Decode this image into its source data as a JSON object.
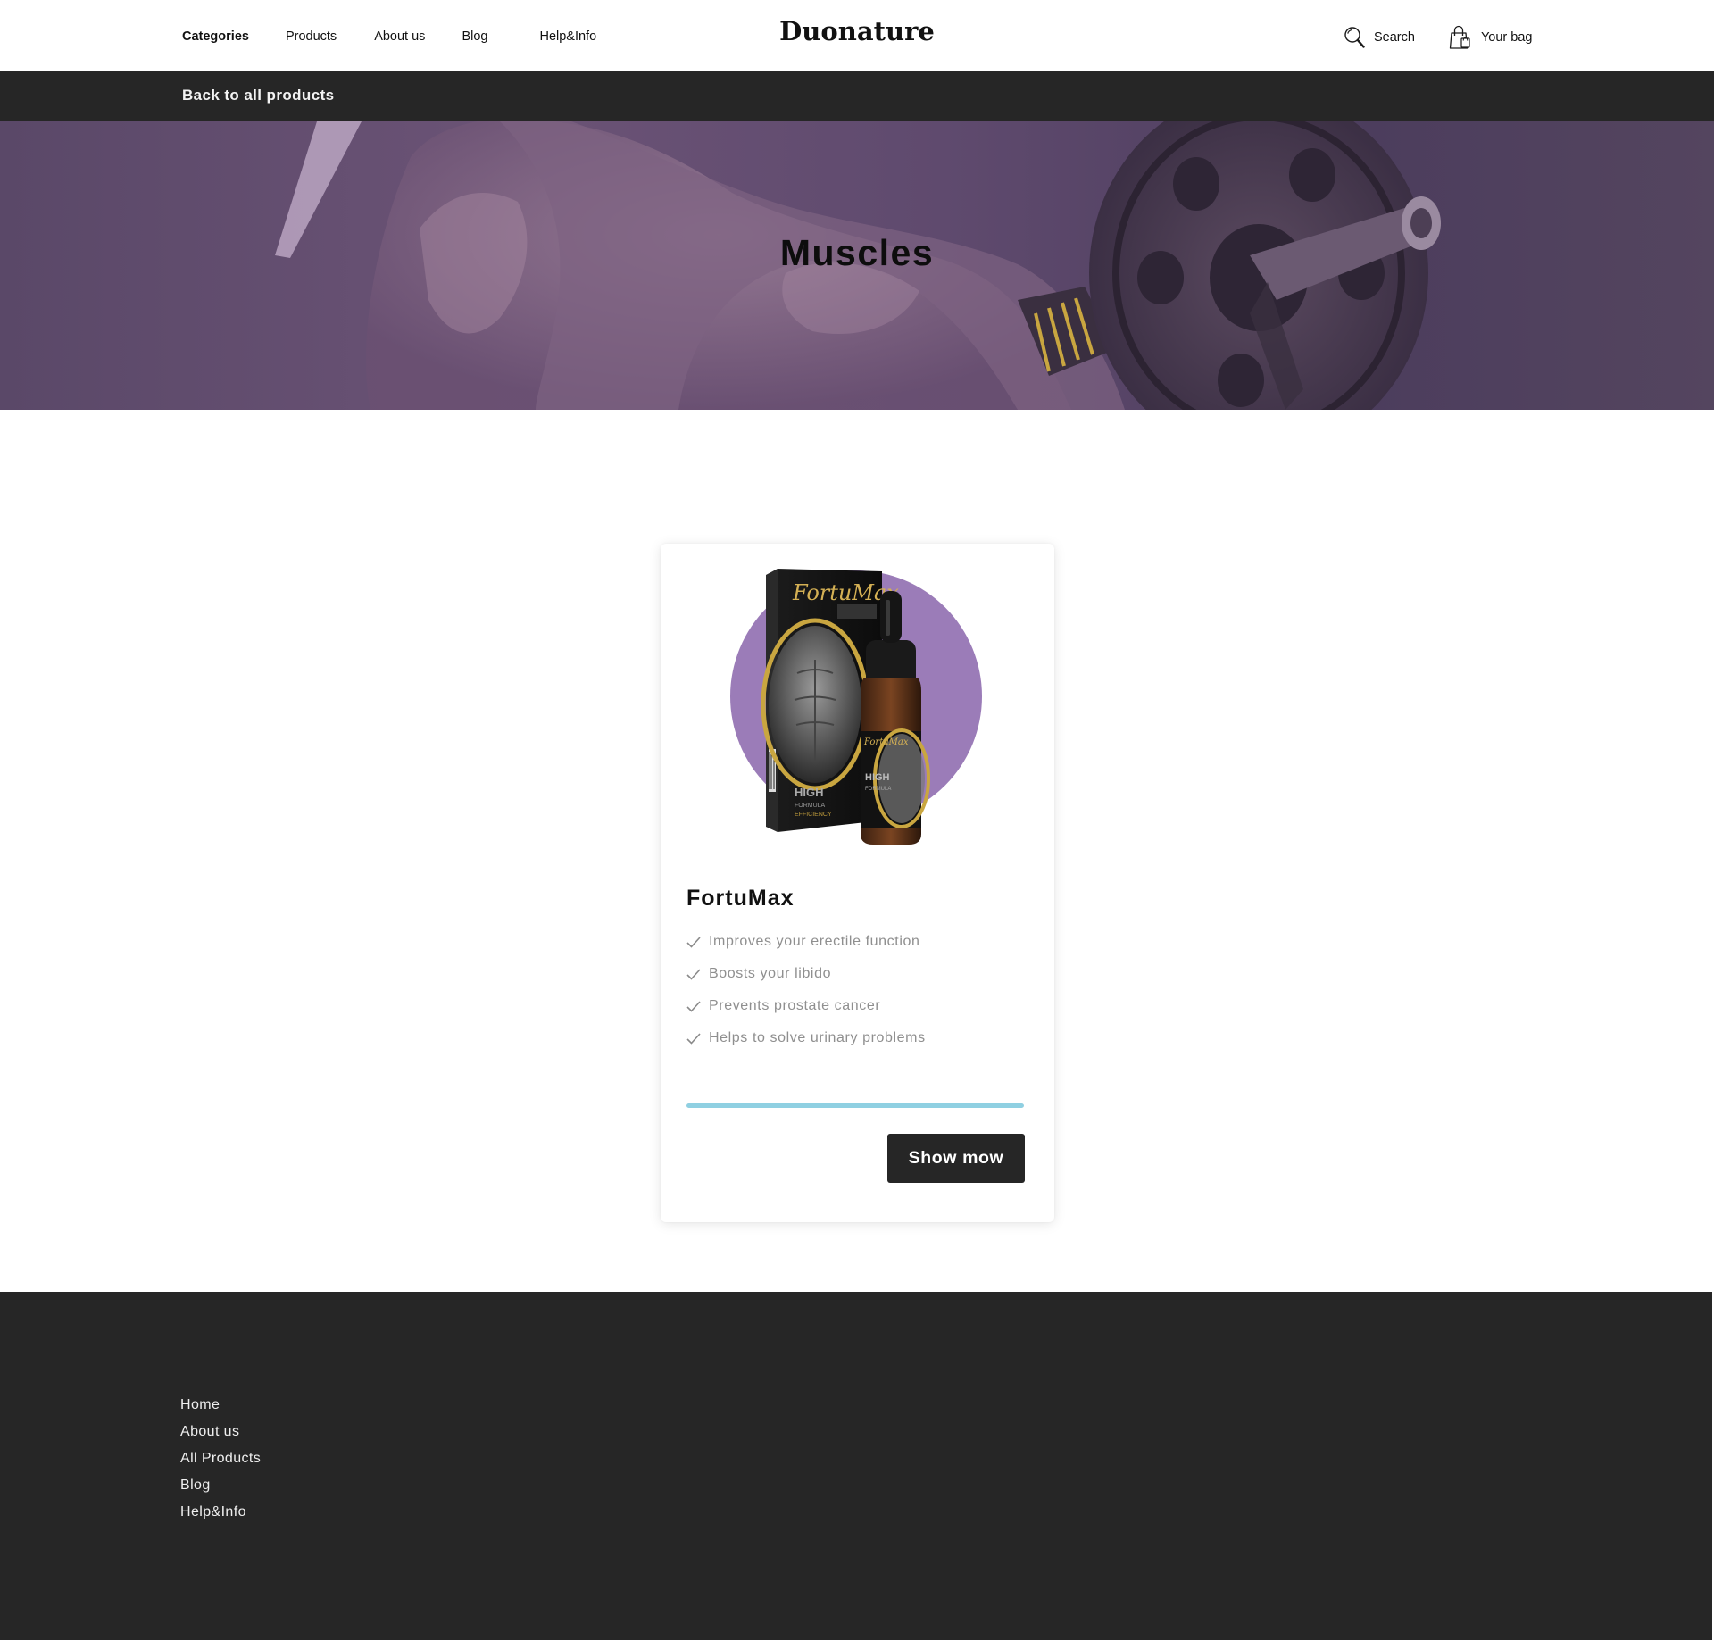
{
  "header": {
    "nav": [
      {
        "label": "Categories",
        "active": true
      },
      {
        "label": "Products",
        "active": false
      },
      {
        "label": "About us",
        "active": false
      },
      {
        "label": "Blog",
        "active": false
      },
      {
        "label": "Help&Info",
        "active": false
      }
    ],
    "logo": "Duonature",
    "search_label": "Search",
    "bag_label": "Your bag",
    "icons": {
      "search": "search-icon",
      "bag": "shopping-bag-icon"
    }
  },
  "backbar": {
    "link_label": "Back to all products"
  },
  "hero": {
    "title": "Muscles"
  },
  "product": {
    "name": "FortuMax",
    "image_label": "FortuMax",
    "features": [
      "Improves your erectile function",
      "Boosts your libido",
      "Prevents prostate cancer",
      "Helps to solve urinary problems"
    ],
    "progress": 1.0,
    "button_label": "Show mow"
  },
  "footer": {
    "links": [
      "Home",
      "About us",
      "All Products",
      "Blog",
      "Help&Info"
    ]
  },
  "colors": {
    "dark": "#262626",
    "hero_overlay": "#5f4a6e",
    "accent_purple": "#9b7cb8",
    "progress": "#8fd0e2",
    "feature_text": "#8f8f8f"
  }
}
